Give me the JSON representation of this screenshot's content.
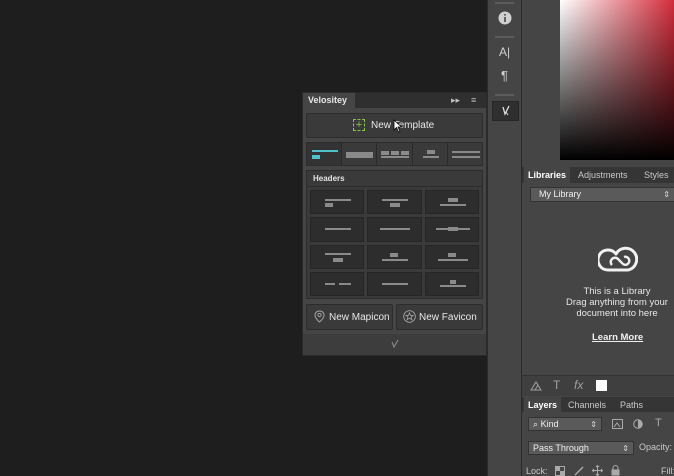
{
  "velosity_panel": {
    "tab": "Velositey",
    "expand_glyph": "▸▸",
    "menu_glyph": "≡",
    "new_template_label": "New Template",
    "headers_title": "Headers",
    "new_mapicon_label": "New Mapicon",
    "new_favicon_label": "New Favicon",
    "accent_color": "#4fc3c9"
  },
  "toolstrip": {
    "icons": [
      "info-icon",
      "type-tool-icon",
      "paragraph-icon",
      "brush-preset-icon"
    ],
    "type_glyph": "A|",
    "paragraph_glyph": "¶",
    "info_glyph": "i"
  },
  "libraries_panel": {
    "tabs": [
      "Libraries",
      "Adjustments",
      "Styles"
    ],
    "library_dropdown": "My Library",
    "empty_title": "This is a Library",
    "empty_line2": "Drag anything from your",
    "empty_line3": "document into here",
    "learn_more": "Learn More",
    "toolbar_type_glyph": "T",
    "toolbar_fx_glyph": "fx"
  },
  "layers_panel": {
    "tabs": [
      "Layers",
      "Channels",
      "Paths"
    ],
    "filter_kind": "Kind",
    "blend_mode": "Pass Through",
    "opacity_label": "Opacity:",
    "lock_label": "Lock:",
    "fill_label": "Fill:",
    "filter_type_glyph": "T"
  }
}
